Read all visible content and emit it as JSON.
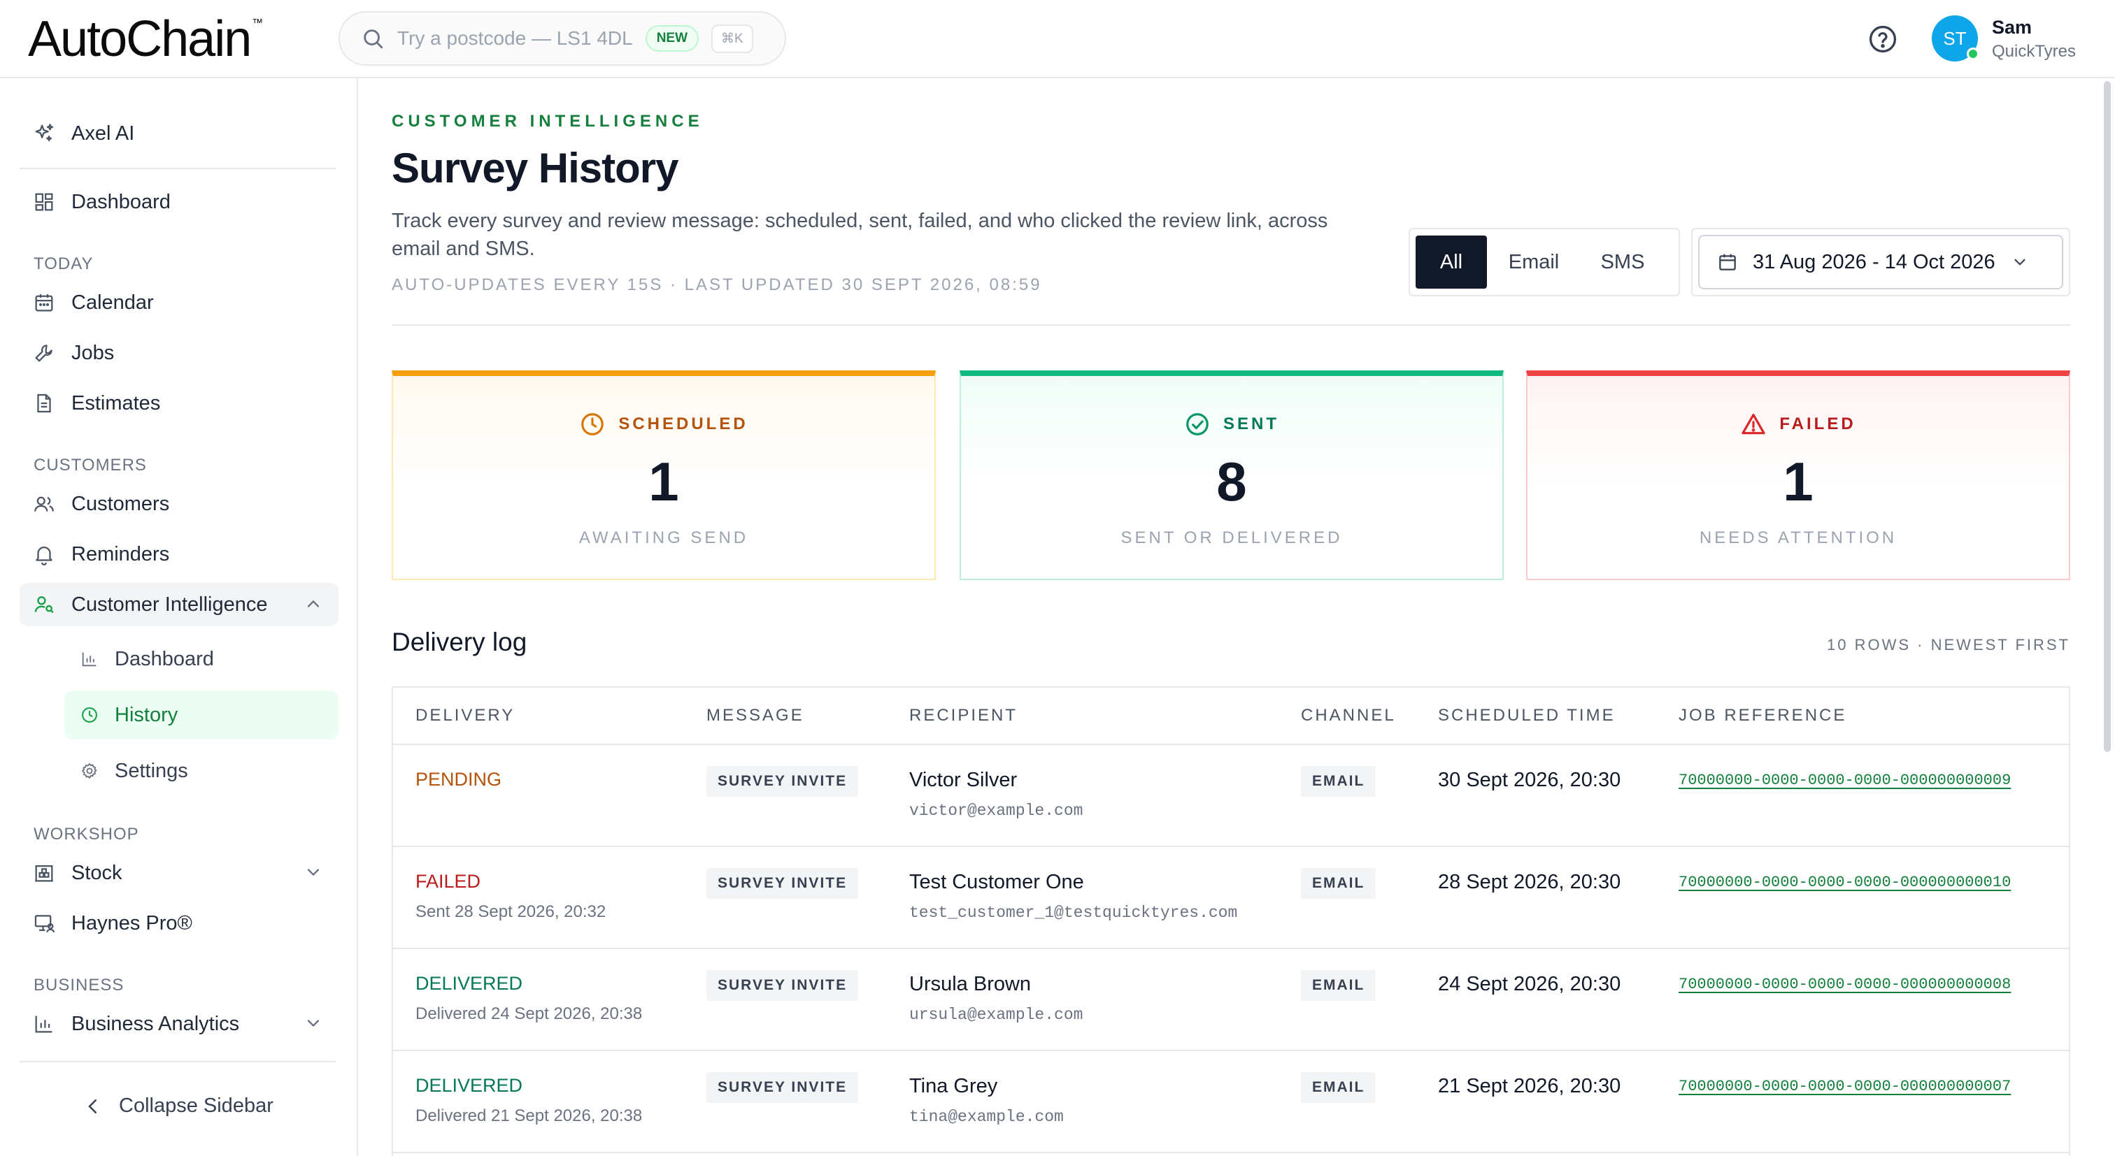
{
  "header": {
    "logo_auto": "Auto",
    "logo_chain": "Chain",
    "logo_tm": "™",
    "search_placeholder": "Try a postcode — LS1 4DL",
    "search_badge": "NEW",
    "search_shortcut": "⌘K",
    "user_initials": "ST",
    "user_name": "Sam",
    "user_org": "QuickTyres"
  },
  "sidebar": {
    "axel": "Axel AI",
    "dashboard": "Dashboard",
    "sections": {
      "today": "TODAY",
      "customers": "CUSTOMERS",
      "workshop": "WORKSHOP",
      "business": "BUSINESS"
    },
    "today_items": [
      "Calendar",
      "Jobs",
      "Estimates"
    ],
    "customer_items": [
      "Customers",
      "Reminders",
      "Customer Intelligence"
    ],
    "ci_sub_items": [
      "Dashboard",
      "History",
      "Settings"
    ],
    "workshop_items": [
      "Stock",
      "Haynes Pro®"
    ],
    "business_items": [
      "Business Analytics"
    ],
    "collapse": "Collapse Sidebar"
  },
  "page": {
    "eyebrow": "CUSTOMER INTELLIGENCE",
    "title": "Survey History",
    "description": "Track every survey and review message: scheduled, sent, failed, and who clicked the review link, across email and SMS.",
    "meta": "AUTO-UPDATES EVERY 15S · LAST UPDATED 30 SEPT 2026, 08:59",
    "filters": [
      "All",
      "Email",
      "SMS"
    ],
    "date_range": "31 Aug 2026 - 14 Oct 2026"
  },
  "stats": {
    "scheduled": {
      "label": "SCHEDULED",
      "value": "1",
      "sub": "AWAITING SEND",
      "color": "#f59e0b"
    },
    "sent": {
      "label": "SENT",
      "value": "8",
      "sub": "SENT OR DELIVERED",
      "color": "#10b981"
    },
    "failed": {
      "label": "FAILED",
      "value": "1",
      "sub": "NEEDS ATTENTION",
      "color": "#ef4444"
    }
  },
  "log": {
    "title": "Delivery log",
    "meta": "10 ROWS · NEWEST FIRST",
    "columns": [
      "DELIVERY",
      "MESSAGE",
      "RECIPIENT",
      "CHANNEL",
      "SCHEDULED TIME",
      "JOB REFERENCE"
    ],
    "rows": [
      {
        "status": "PENDING",
        "status_sub": "",
        "message": "SURVEY INVITE",
        "name": "Victor Silver",
        "email": "victor@example.com",
        "channel": "EMAIL",
        "time": "30 Sept 2026, 20:30",
        "job": "70000000-0000-0000-0000-000000000009"
      },
      {
        "status": "FAILED",
        "status_sub": "Sent 28 Sept 2026, 20:32",
        "message": "SURVEY INVITE",
        "name": "Test Customer One",
        "email": "test_customer_1@testquicktyres.com",
        "channel": "EMAIL",
        "time": "28 Sept 2026, 20:30",
        "job": "70000000-0000-0000-0000-000000000010"
      },
      {
        "status": "DELIVERED",
        "status_sub": "Delivered 24 Sept 2026, 20:38",
        "message": "SURVEY INVITE",
        "name": "Ursula Brown",
        "email": "ursula@example.com",
        "channel": "EMAIL",
        "time": "24 Sept 2026, 20:30",
        "job": "70000000-0000-0000-0000-000000000008"
      },
      {
        "status": "DELIVERED",
        "status_sub": "Delivered 21 Sept 2026, 20:38",
        "message": "SURVEY INVITE",
        "name": "Tina Grey",
        "email": "tina@example.com",
        "channel": "EMAIL",
        "time": "21 Sept 2026, 20:30",
        "job": "70000000-0000-0000-0000-000000000007"
      }
    ]
  }
}
